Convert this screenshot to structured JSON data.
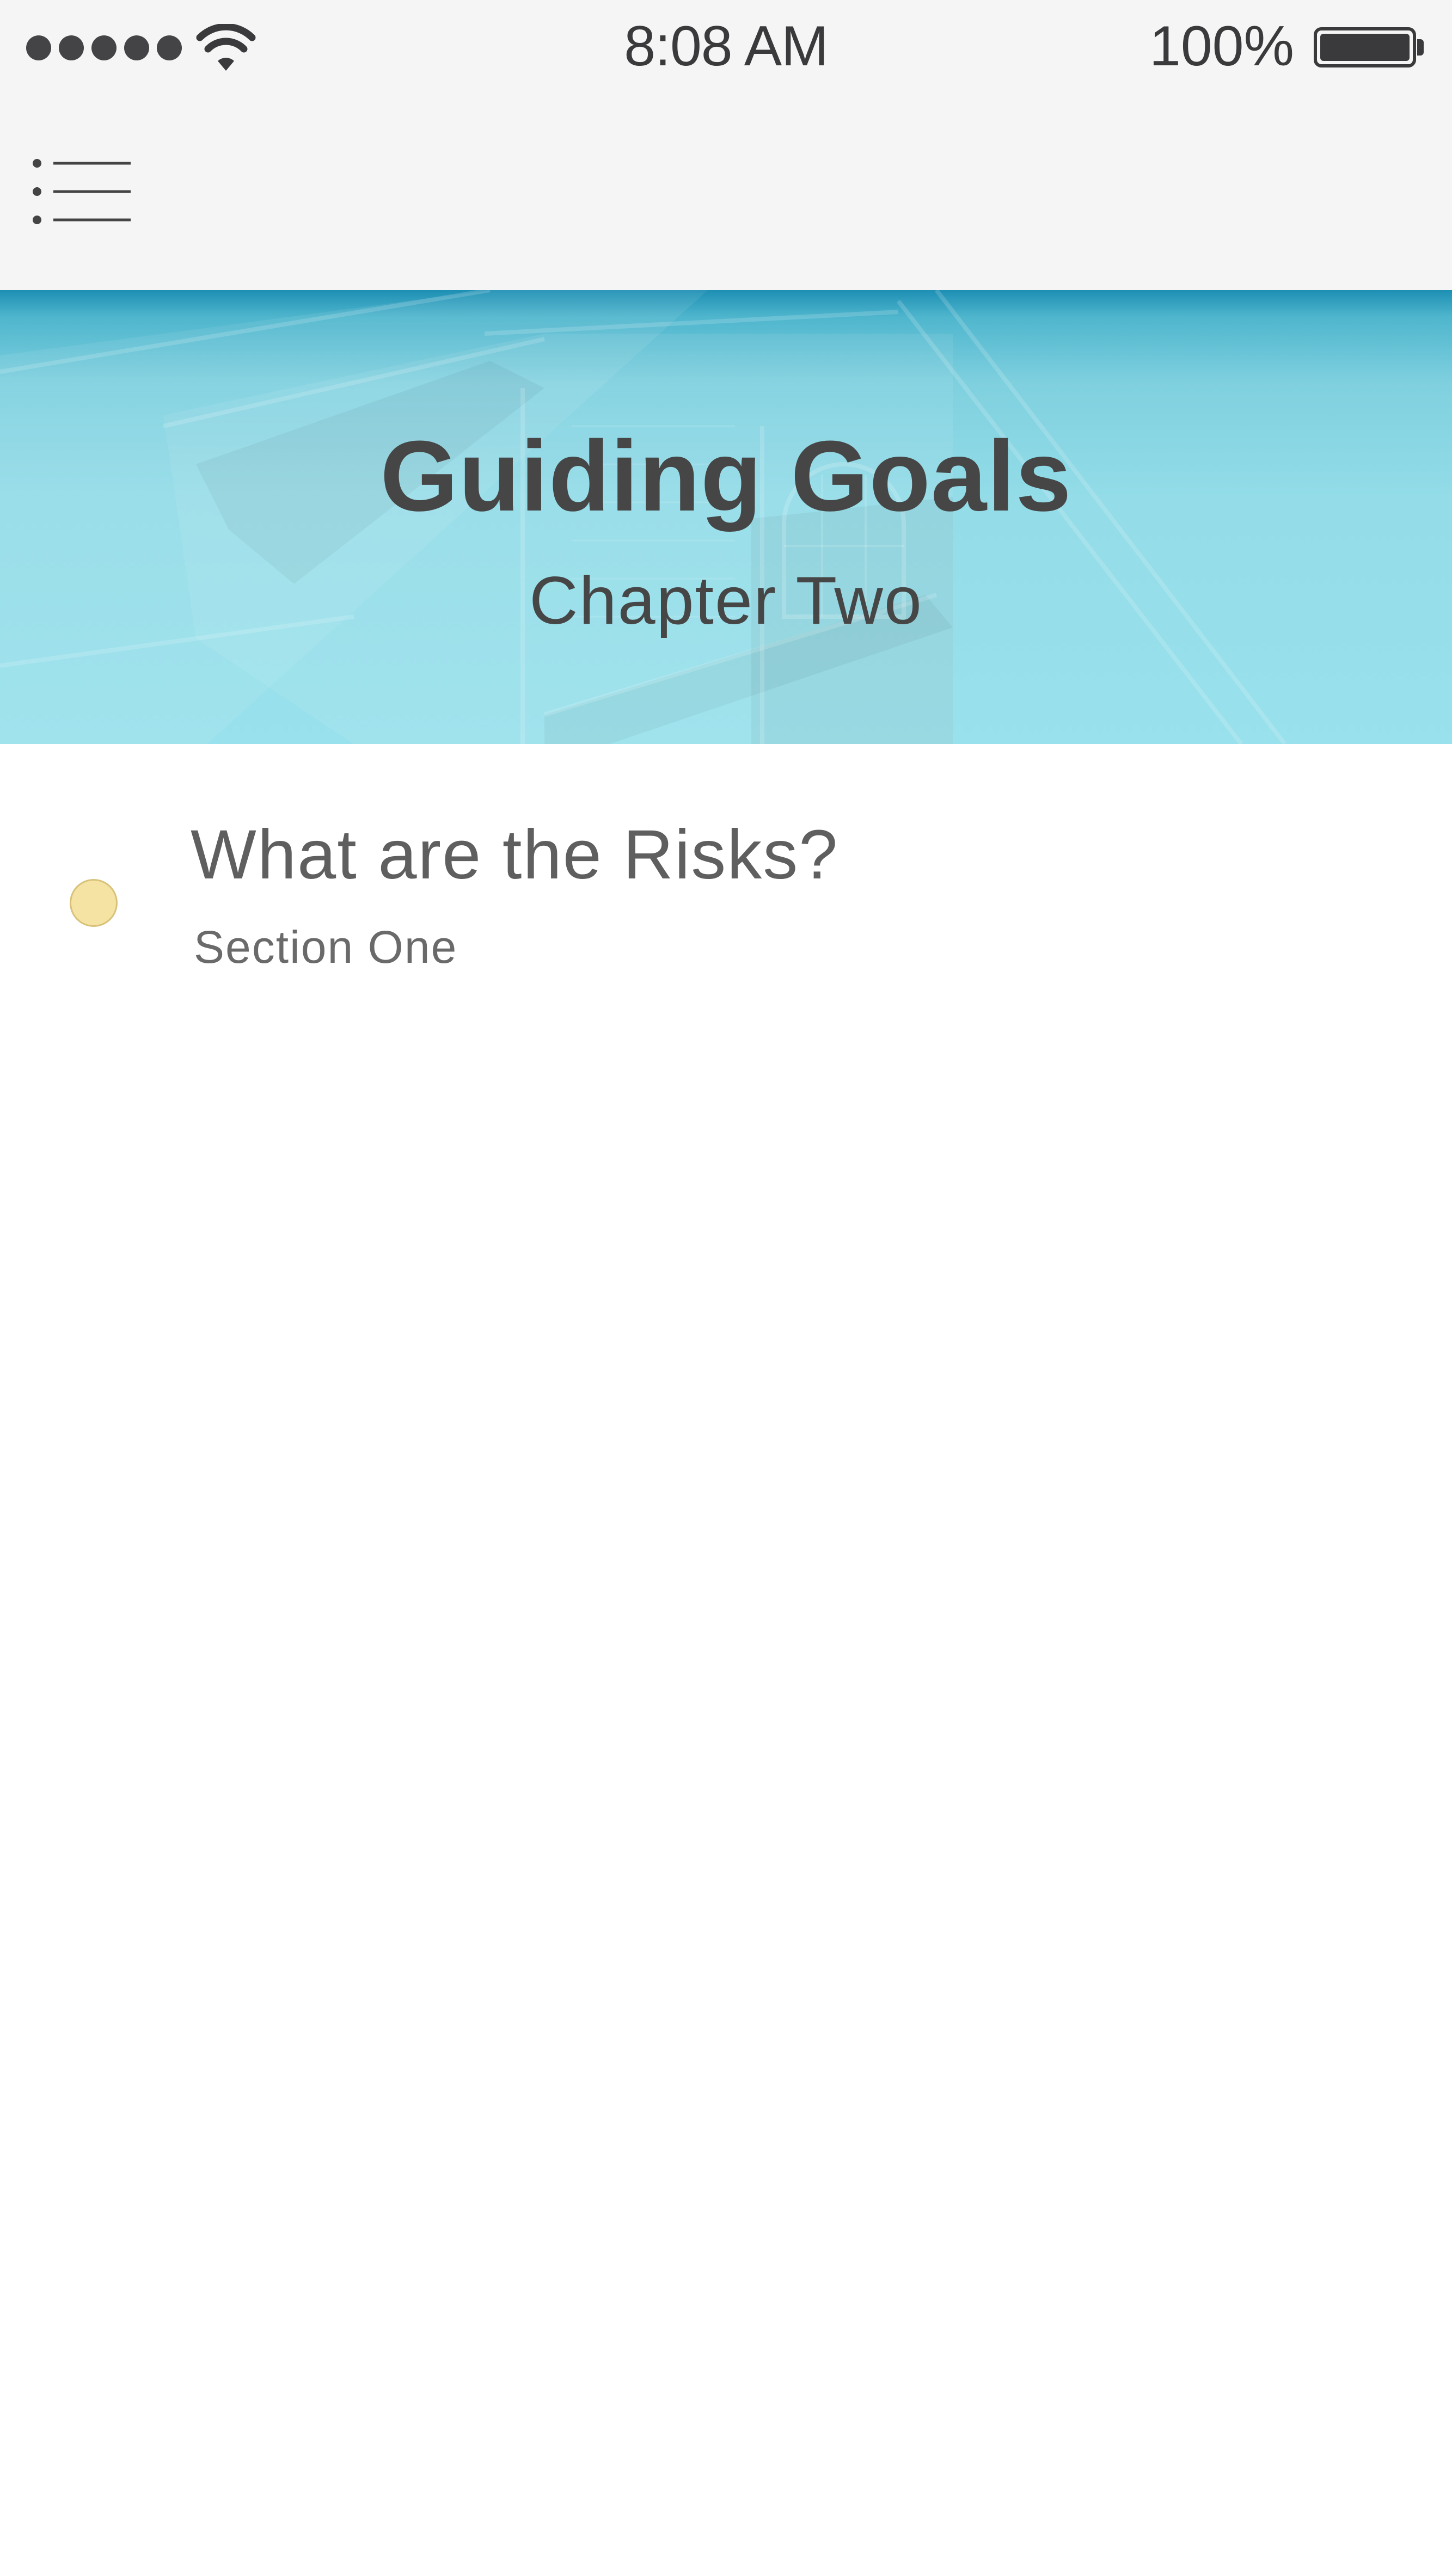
{
  "status_bar": {
    "time": "8:08 AM",
    "battery_percent": "100%",
    "battery_level": 1.0,
    "signal_bars": 5,
    "icons": [
      "signal-icon",
      "wifi-icon",
      "battery-icon"
    ]
  },
  "nav": {
    "menu_icon": "menu-list-icon"
  },
  "hero": {
    "title": "Guiding Goals",
    "subtitle": "Chapter Two"
  },
  "sections": [
    {
      "title": "What are the Risks?",
      "subtitle": "Section One",
      "status_color": "#f5e3a3"
    }
  ],
  "colors": {
    "hero_accent": "#93dce8",
    "hero_top": "#1d8fb4",
    "text": "#464646",
    "status_dot": "#f5e3a3"
  }
}
